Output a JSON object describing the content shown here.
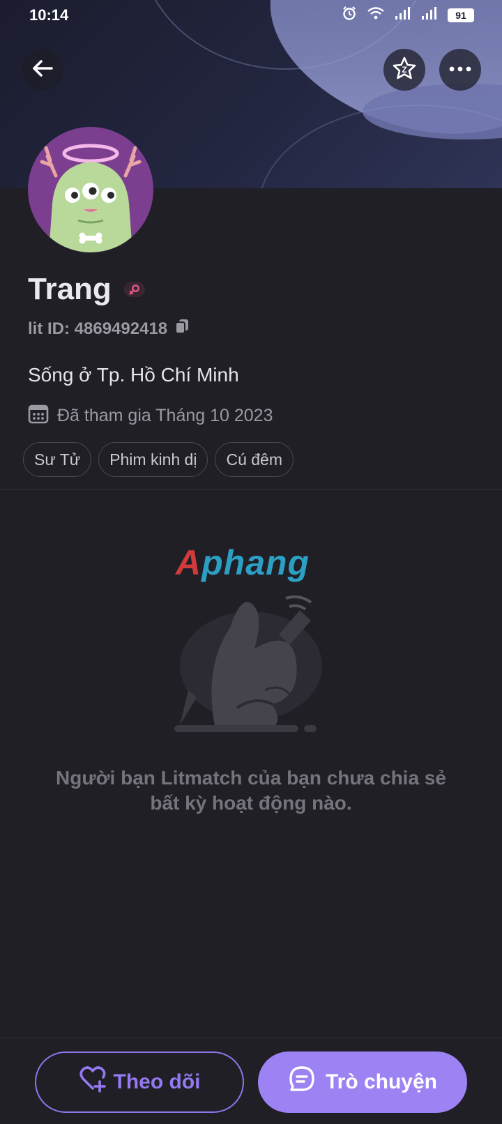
{
  "status_bar": {
    "time": "10:14",
    "battery": "91"
  },
  "header": {
    "back_icon": "arrow-left-icon",
    "favorite_icon": "star-icon",
    "more_icon": "more-horizontal-icon"
  },
  "profile": {
    "name": "Trang",
    "gender_icon": "female-icon",
    "lit_id": "lit ID: 4869492418",
    "copy_icon": "copy-icon",
    "location": "Sống ở Tp. Hồ Chí Minh",
    "joined": "Đã tham gia Tháng 10 2023",
    "tags": [
      "Sư Tử",
      "Phim kinh dị",
      "Cú đêm"
    ]
  },
  "watermark": {
    "first_letter": "A",
    "rest": "phang"
  },
  "empty_state": {
    "message": "Người bạn Litmatch của bạn chưa chia sẻ bất kỳ hoạt động nào."
  },
  "actions": {
    "follow_label": "Theo dõi",
    "chat_label": "Trò chuyện"
  },
  "colors": {
    "accent": "#9c82f2",
    "background": "#201f26",
    "avatar_bg": "#7c3f8f",
    "gender_pink": "#e0577f"
  }
}
